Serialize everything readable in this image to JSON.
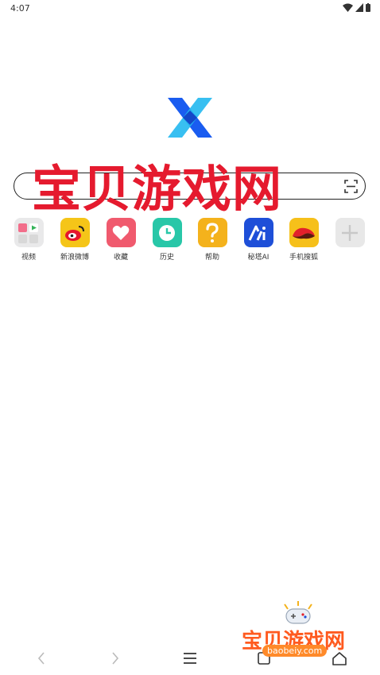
{
  "status_bar": {
    "time": "4:07"
  },
  "watermark": {
    "text": "宝贝游戏网"
  },
  "shortcuts": [
    {
      "label": "视频",
      "icon": "video-folder-icon"
    },
    {
      "label": "新浪微博",
      "icon": "weibo-icon",
      "color": "#f5c518"
    },
    {
      "label": "收藏",
      "icon": "heart-icon",
      "color": "#f05a6e"
    },
    {
      "label": "历史",
      "icon": "clock-icon",
      "color": "#28c7a8"
    },
    {
      "label": "帮助",
      "icon": "question-icon",
      "color": "#f4b21c"
    },
    {
      "label": "秘塔AI",
      "icon": "metaso-icon",
      "color": "#1e4fd8"
    },
    {
      "label": "手机搜狐",
      "icon": "sohu-icon",
      "color": "#f6c01a"
    },
    {
      "label": "",
      "icon": "add-icon",
      "color": "#e8e8e8"
    }
  ],
  "badge": {
    "text": "宝贝游戏网",
    "url": "baobeiy.com"
  },
  "colors": {
    "logo_blue": "#1a5cf0",
    "logo_cyan": "#22b8f0",
    "watermark": "#e51a2e"
  }
}
